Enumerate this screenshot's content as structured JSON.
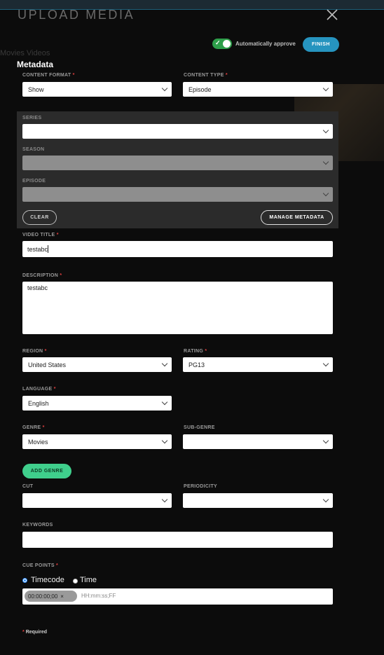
{
  "header": {
    "title": "UPLOAD MEDIA",
    "auto_approve_label": "Automatically approve",
    "finish_label": "FINISH"
  },
  "background": {
    "ghost_heading": "Movies Videos"
  },
  "metadata": {
    "section_title": "Metadata",
    "content_format": {
      "label": "CONTENT FORMAT",
      "value": "Show"
    },
    "content_type": {
      "label": "CONTENT TYPE",
      "value": "Episode"
    },
    "series": {
      "label": "SERIES",
      "value": ""
    },
    "season": {
      "label": "SEASON",
      "value": ""
    },
    "episode": {
      "label": "EPISODE",
      "value": ""
    },
    "clear_label": "CLEAR",
    "manage_label": "MANAGE METADATA",
    "video_title": {
      "label": "VIDEO TITLE",
      "value": "testabc"
    },
    "description": {
      "label": "DESCRIPTION",
      "value": "testabc"
    },
    "region": {
      "label": "REGION",
      "value": "United States"
    },
    "rating": {
      "label": "RATING",
      "value": "PG13"
    },
    "language": {
      "label": "LANGUAGE",
      "value": "English"
    },
    "genre": {
      "label": "GENRE",
      "value": "Movies"
    },
    "sub_genre": {
      "label": "SUB-GENRE",
      "value": ""
    },
    "add_genre_label": "ADD GENRE",
    "cut": {
      "label": "CUT",
      "value": ""
    },
    "periodicity": {
      "label": "PERIODICITY",
      "value": ""
    },
    "keywords": {
      "label": "KEYWORDS",
      "value": ""
    },
    "cue_points": {
      "label": "CUE POINTS",
      "option_timecode": "Timecode",
      "option_time": "Time",
      "chip": "00:00:00;00",
      "chip_remove": "×",
      "placeholder": "HH:mm:ss;FF"
    },
    "required_star": "*",
    "required_note": "Required"
  },
  "colors": {
    "accent_blue": "#2694bf",
    "toggle_green": "#2e9e4a",
    "add_genre_green": "#3fcf8c",
    "required_red": "#e04040"
  }
}
